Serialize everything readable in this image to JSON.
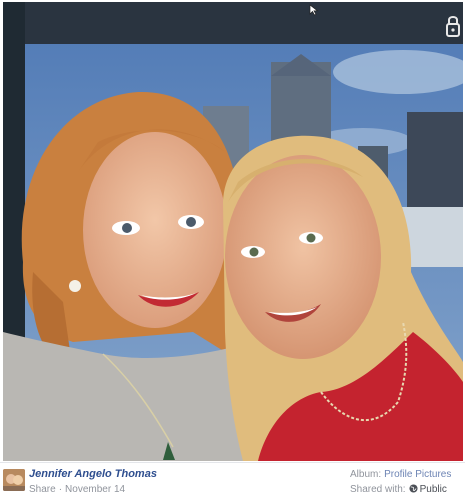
{
  "post": {
    "author_name": "Jennifer Angelo Thomas",
    "share_label": "Share",
    "separator": "·",
    "date": "November 14",
    "album_label": "Album:",
    "album_name": "Profile Pictures",
    "shared_with_label": "Shared with:",
    "privacy": "Public"
  },
  "icons": {
    "cursor": "mouse-pointer-icon",
    "lock": "lock-icon",
    "globe": "globe-icon"
  },
  "colors": {
    "link_blue": "#2e4e8f",
    "muted_gray": "#90949c",
    "album_link": "#6d84b4"
  }
}
